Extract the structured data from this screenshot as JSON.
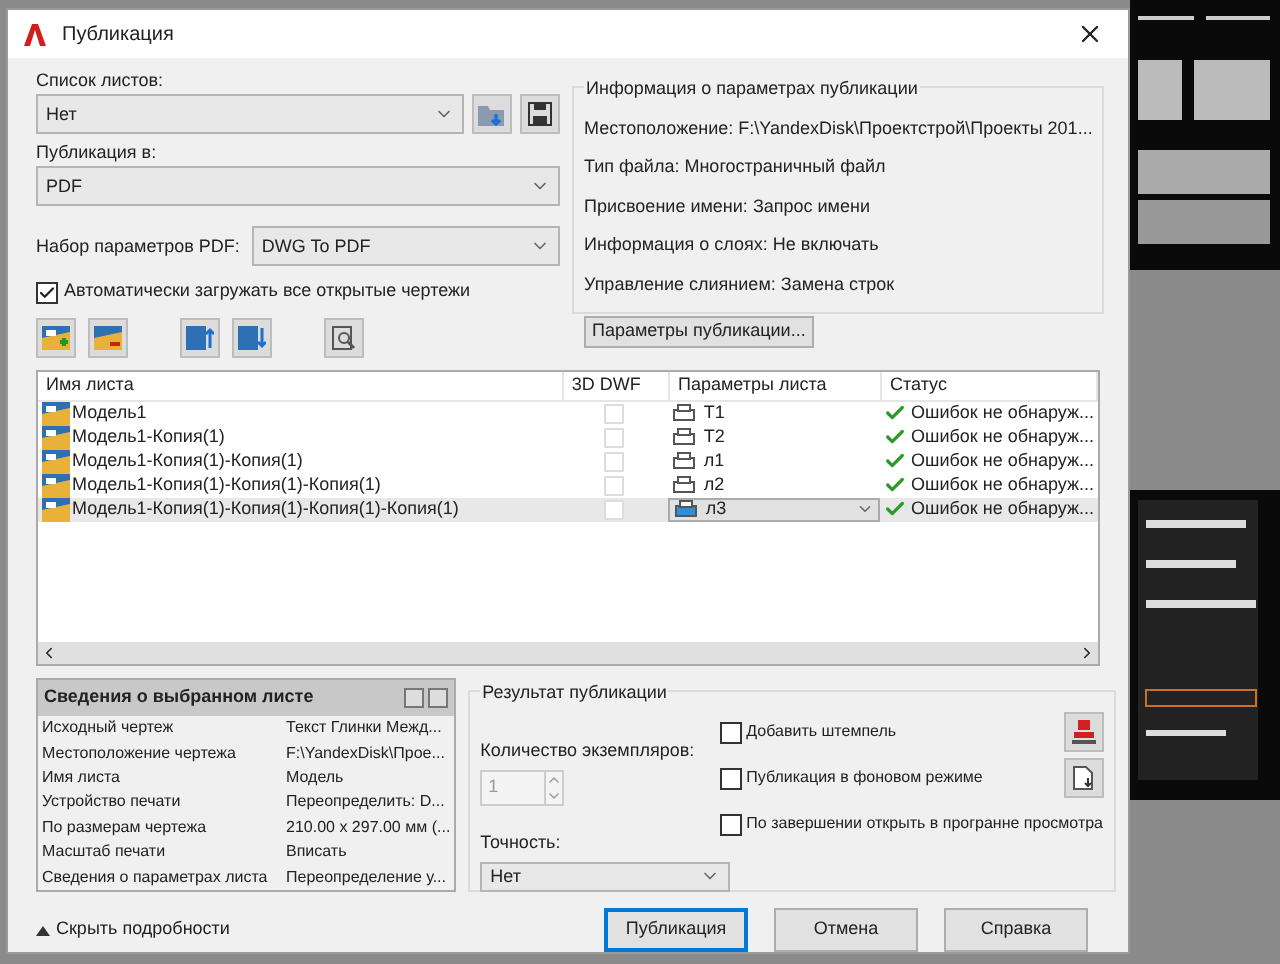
{
  "window": {
    "title": "Публикация"
  },
  "sheet_list": {
    "label": "Список листов:",
    "value": "Нет"
  },
  "publish_to": {
    "label": "Публикация в:",
    "value": "PDF"
  },
  "pdf_preset": {
    "label": "Набор параметров PDF:",
    "value": "DWG To PDF"
  },
  "auto_load": {
    "label": "Автоматически загружать все открытые чертежи",
    "checked": true
  },
  "info": {
    "title": "Информация о параметрах публикации",
    "rows": [
      {
        "label": "Местоположение:",
        "value": "F:\\YandexDisk\\Проектстрой\\Проекты 201..."
      },
      {
        "label": "Тип файла:",
        "value": "Многостраничный файл"
      },
      {
        "label": "Присвоение имени:",
        "value": "Запрос имени"
      },
      {
        "label": "Информация о слоях:",
        "value": "Не включать"
      },
      {
        "label": "Управление слиянием:",
        "value": "Замена строк"
      }
    ],
    "button": "Параметры публикации..."
  },
  "table": {
    "columns": [
      "Имя листа",
      "3D DWF",
      "Параметры листа",
      "Статус"
    ],
    "rows": [
      {
        "name": "Модель1",
        "dwf": false,
        "setup": "T1",
        "status": "Ошибок не обнаруж...",
        "selected": false
      },
      {
        "name": "Модель1-Копия(1)",
        "dwf": false,
        "setup": "T2",
        "status": "Ошибок не обнаруж...",
        "selected": false
      },
      {
        "name": "Модель1-Копия(1)-Копия(1)",
        "dwf": false,
        "setup": "л1",
        "status": "Ошибок не обнаруж...",
        "selected": false
      },
      {
        "name": "Модель1-Копия(1)-Копия(1)-Копия(1)",
        "dwf": false,
        "setup": "л2",
        "status": "Ошибок не обнаруж...",
        "selected": false
      },
      {
        "name": "Модель1-Копия(1)-Копия(1)-Копия(1)-Копия(1)",
        "dwf": false,
        "setup": "л3",
        "status": "Ошибок не обнаруж...",
        "selected": true
      }
    ]
  },
  "details": {
    "title": "Сведения о выбранном листе",
    "rows": [
      {
        "label": "Исходный чертеж",
        "value": "Текст Глинки Межд..."
      },
      {
        "label": "Местоположение чертежа",
        "value": "F:\\YandexDisk\\Прое..."
      },
      {
        "label": "Имя листа",
        "value": "Модель"
      },
      {
        "label": "Устройство печати",
        "value": "Переопределить: D..."
      },
      {
        "label": "По размерам чертежа",
        "value": "210.00 x 297.00 мм (..."
      },
      {
        "label": "Масштаб печати",
        "value": "Вписать"
      },
      {
        "label": "Сведения о параметрах листа",
        "value": "Переопределение у..."
      }
    ]
  },
  "result": {
    "title": "Результат публикации",
    "copies_label": "Количество экземпляров:",
    "copies": "1",
    "precision_label": "Точность:",
    "precision": "Нет",
    "options": [
      {
        "label": "Добавить штемпель",
        "checked": false
      },
      {
        "label": "Публикация в фоновом режиме",
        "checked": false
      },
      {
        "label": "По завершении открыть в програнне просмотра",
        "checked": false
      }
    ]
  },
  "hide_details": "Скрыть подробности",
  "buttons": [
    {
      "label": "Публикация",
      "default": true
    },
    {
      "label": "Отмена",
      "default": false
    },
    {
      "label": "Справка",
      "default": false
    }
  ]
}
